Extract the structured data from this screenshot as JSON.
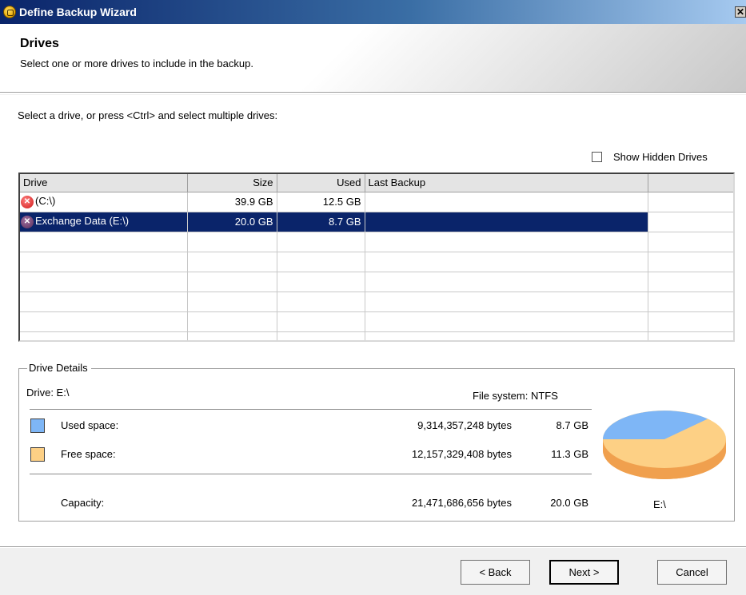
{
  "window": {
    "title": "Define Backup Wizard",
    "close_glyph": "✕"
  },
  "header": {
    "title": "Drives",
    "subtitle": "Select one or more drives to include in the backup."
  },
  "instruction": "Select a drive, or press <Ctrl> and select multiple drives:",
  "show_hidden": {
    "label": "Show Hidden Drives",
    "checked": false
  },
  "grid": {
    "columns": [
      "Drive",
      "Size",
      "Used",
      "Last Backup"
    ],
    "rows": [
      {
        "drive": "(C:\\)",
        "size": "39.9 GB",
        "used": "12.5 GB",
        "last_backup": "",
        "icon": "drive-error-icon",
        "selected": false
      },
      {
        "drive": "Exchange Data (E:\\)",
        "size": "20.0 GB",
        "used": "8.7 GB",
        "last_backup": "",
        "icon": "drive-error-icon",
        "selected": true
      }
    ]
  },
  "details": {
    "legend": "Drive Details",
    "drive_label": "Drive: E:\\",
    "filesystem": "File system: NTFS",
    "used": {
      "label": "Used space:",
      "bytes": "9,314,357,248 bytes",
      "gb": "8.7 GB",
      "color": "#7eb6f6"
    },
    "free": {
      "label": "Free space:",
      "bytes": "12,157,329,408 bytes",
      "gb": "11.3 GB",
      "color": "#fdd085"
    },
    "capacity": {
      "label": "Capacity:",
      "bytes": "21,471,686,656 bytes",
      "gb": "20.0 GB"
    },
    "pie_label": "E:\\",
    "pie_side_color": "#f0a04e"
  },
  "buttons": {
    "back": "< Back",
    "next": "Next >",
    "cancel": "Cancel"
  }
}
